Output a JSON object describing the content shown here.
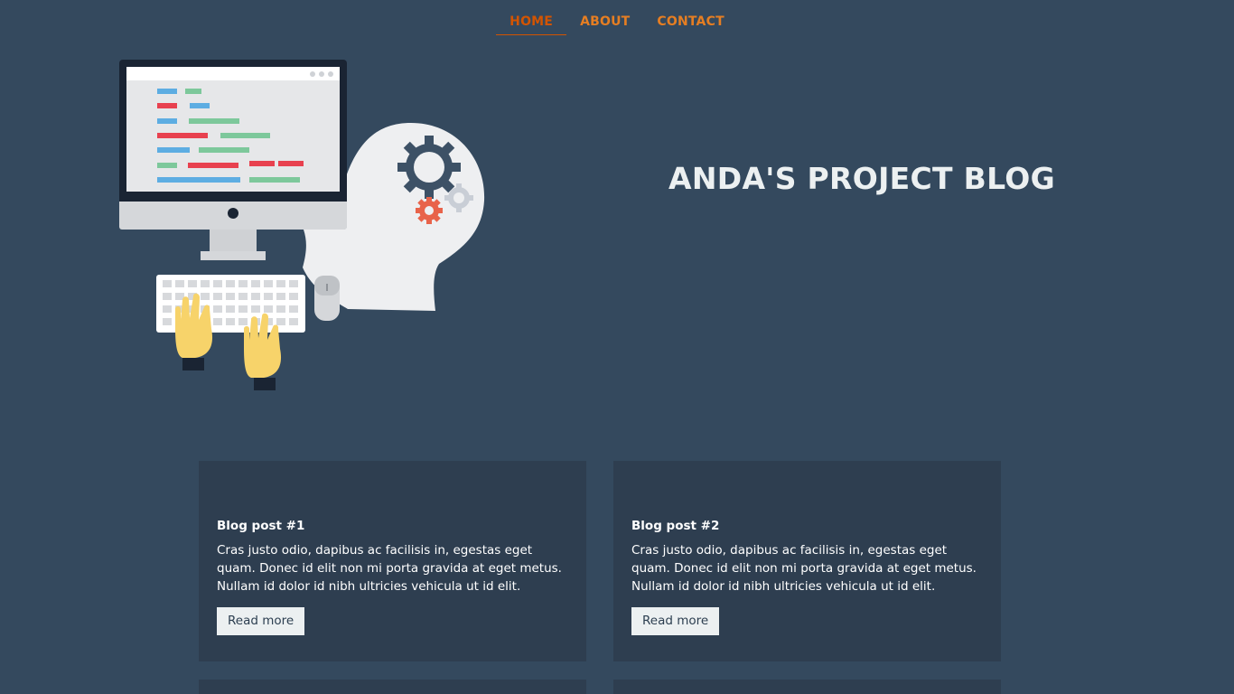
{
  "nav": {
    "items": [
      {
        "label": "HOME",
        "active": true
      },
      {
        "label": "ABOUT",
        "active": false
      },
      {
        "label": "CONTACT",
        "active": false
      }
    ]
  },
  "hero": {
    "title": "ANDA'S PROJECT BLOG"
  },
  "posts": [
    {
      "title": "Blog post #1",
      "body": "Cras justo odio, dapibus ac facilisis in, egestas eget quam. Donec id elit non mi porta gravida at eget metus. Nullam id dolor id nibh ultricies vehicula ut id elit.",
      "button": "Read more"
    },
    {
      "title": "Blog post #2",
      "body": "Cras justo odio, dapibus ac facilisis in, egestas eget quam. Donec id elit non mi porta gravida at eget metus. Nullam id dolor id nibh ultricies vehicula ut id elit.",
      "button": "Read more"
    }
  ],
  "colors": {
    "background": "#34495e",
    "card": "#2e3e50",
    "accent": "#e67e22",
    "accent_active": "#d35400",
    "button_bg": "#ecf0f1"
  }
}
